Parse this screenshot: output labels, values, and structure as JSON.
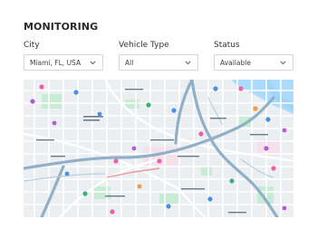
{
  "header": {
    "title": "MONITORING"
  },
  "filters": [
    {
      "label": "City",
      "value": "Miami, FL, USA"
    },
    {
      "label": "Vehicle Type",
      "value": "All"
    },
    {
      "label": "Status",
      "value": "Available"
    }
  ],
  "map": {
    "icons": {
      "chevron": "chevron-down-icon",
      "pin": "map-pin-icon"
    },
    "colors": {
      "land": "#eceff2",
      "water": "#aadaff",
      "park": "#c8ecd3",
      "highway": "#8fb0c8",
      "road": "#ffffff",
      "poi_pink": "#ef5fa7",
      "poi_purple": "#b15cd8",
      "poi_blue": "#4a90e2",
      "poi_orange": "#f29b38",
      "poi_green": "#3bb273"
    }
  }
}
